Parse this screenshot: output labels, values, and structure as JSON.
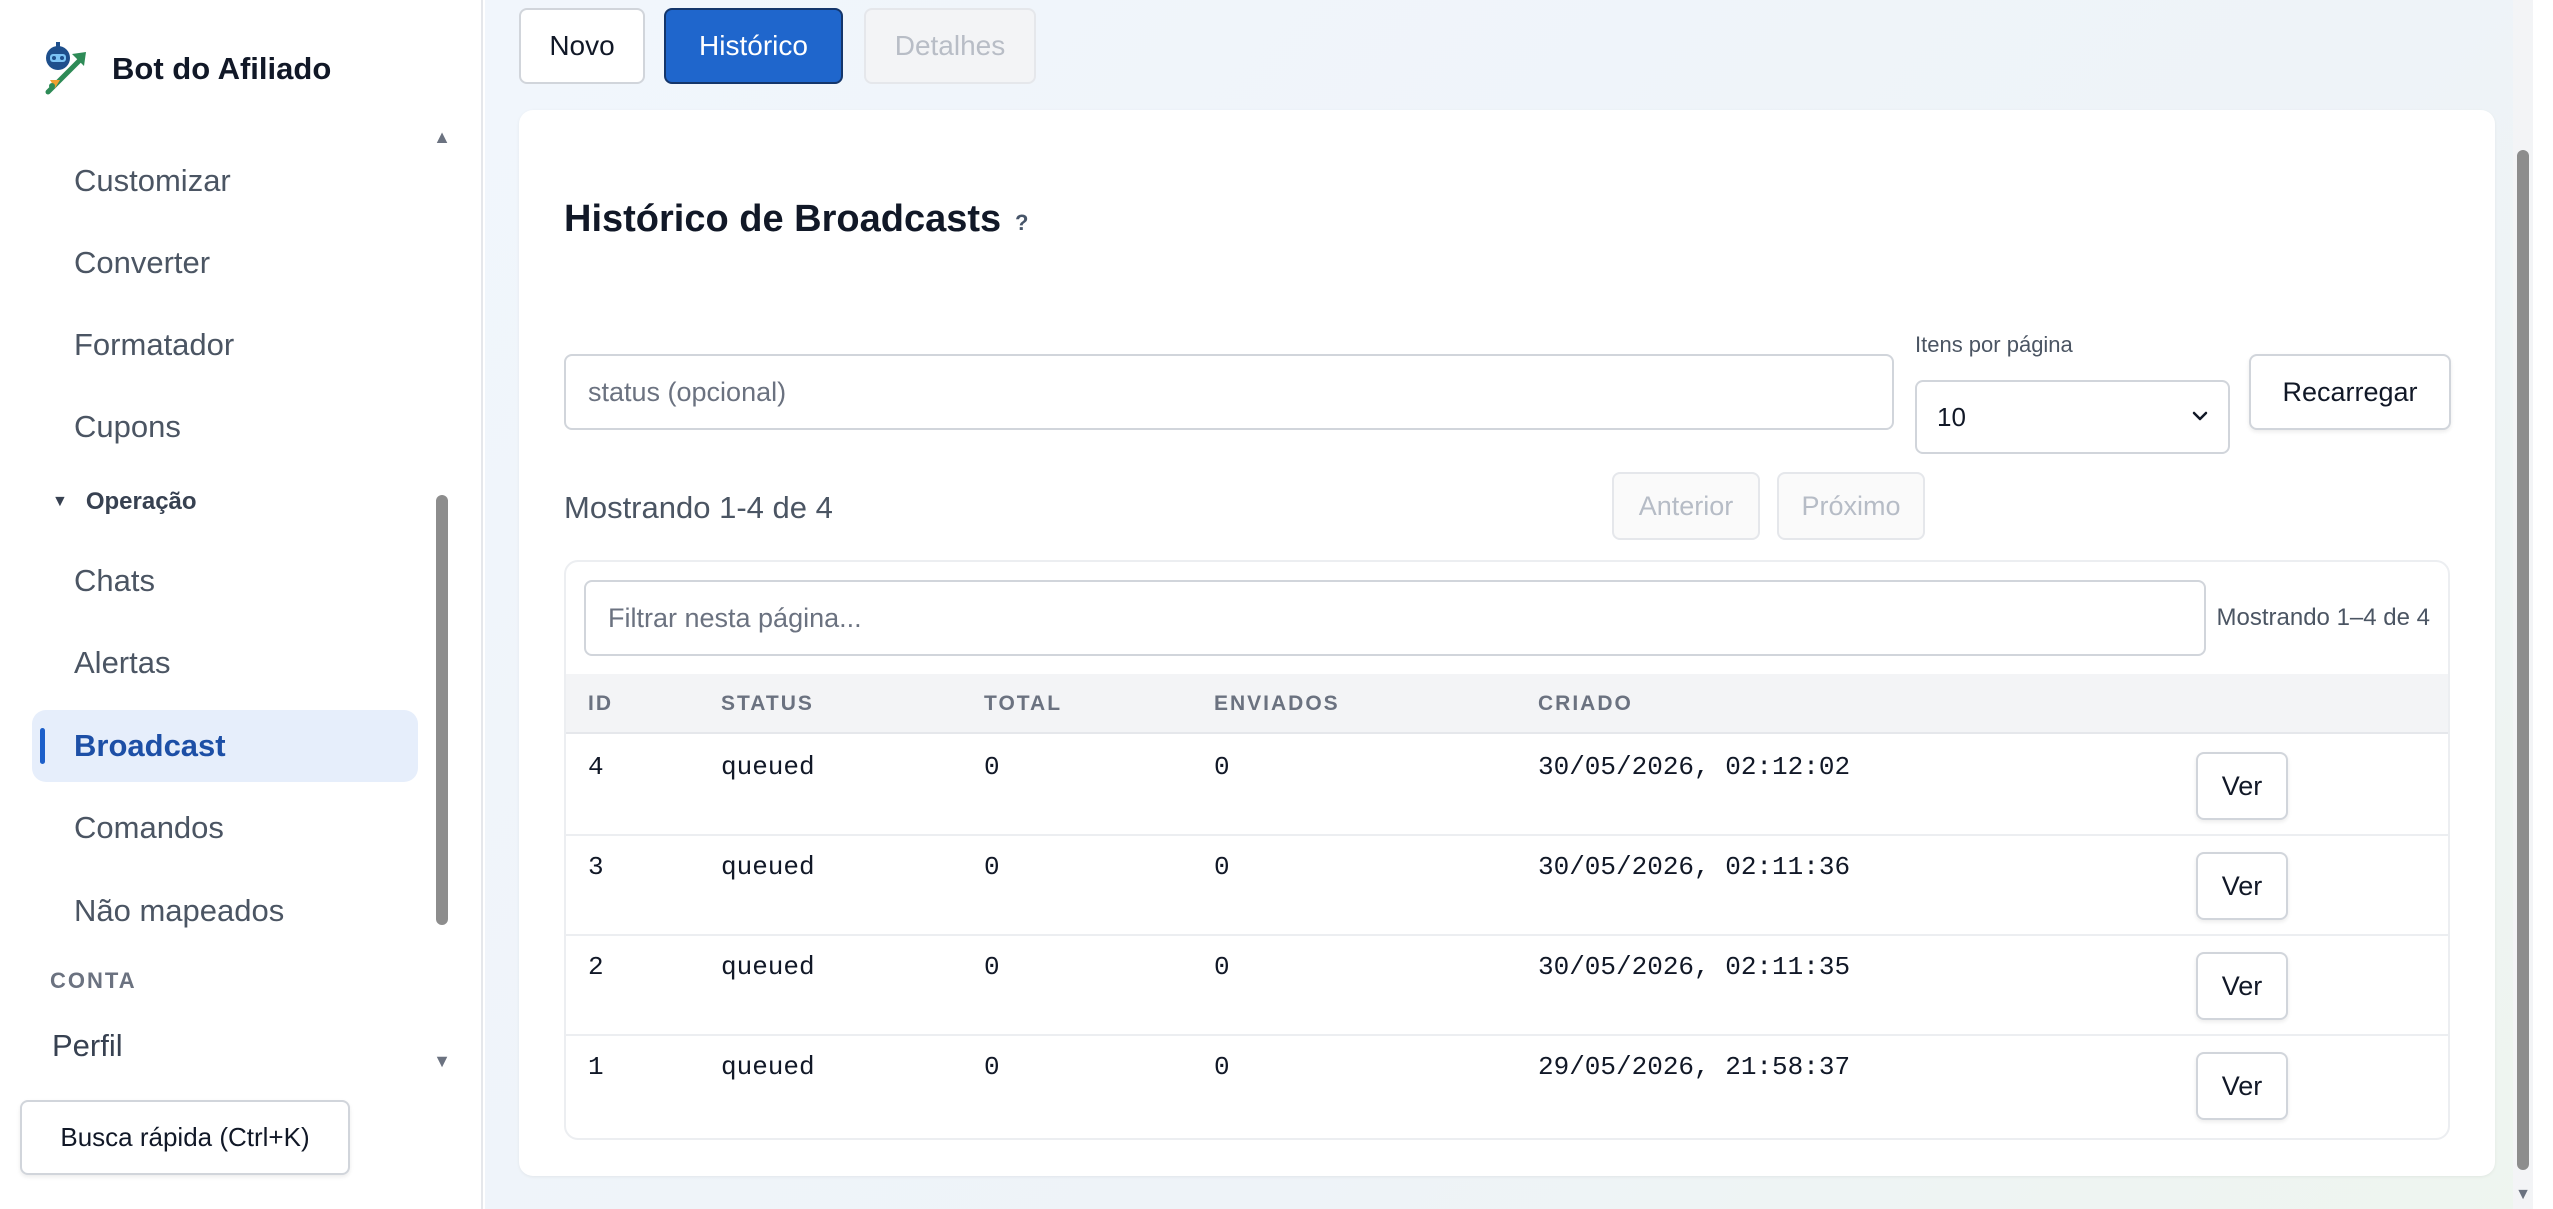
{
  "brand": {
    "name": "Bot do Afiliado",
    "logo": "robot-rocket-logo"
  },
  "sidebar": {
    "items": [
      {
        "label": "Customizar"
      },
      {
        "label": "Converter"
      },
      {
        "label": "Formatador"
      },
      {
        "label": "Cupons"
      }
    ],
    "group": {
      "label": "Operação",
      "icon": "caret-down-icon"
    },
    "group_items": [
      {
        "label": "Chats"
      },
      {
        "label": "Alertas"
      },
      {
        "label": "Broadcast",
        "active": true
      },
      {
        "label": "Comandos"
      },
      {
        "label": "Não mapeados"
      }
    ],
    "section_label": "CONTA",
    "account_items": [
      {
        "label": "Perfil"
      }
    ],
    "quick_search": "Busca rápida (Ctrl+K)"
  },
  "tabs": [
    {
      "label": "Novo",
      "state": "default"
    },
    {
      "label": "Histórico",
      "state": "active"
    },
    {
      "label": "Detalhes",
      "state": "disabled"
    }
  ],
  "card": {
    "title": "Histórico de Broadcasts",
    "help": "?",
    "status_placeholder": "status (opcional)",
    "items_per_page_label": "Itens por página",
    "items_per_page_value": "10",
    "reload_label": "Recarregar",
    "showing_text": "Mostrando 1-4 de 4",
    "prev_label": "Anterior",
    "next_label": "Próximo"
  },
  "table": {
    "filter_placeholder": "Filtrar nesta página...",
    "showing_text": "Mostrando 1–4 de 4",
    "columns": [
      "ID",
      "STATUS",
      "TOTAL",
      "ENVIADOS",
      "CRIADO"
    ],
    "rows": [
      {
        "id": "4",
        "status": "queued",
        "total": "0",
        "enviados": "0",
        "criado": "30/05/2026, 02:12:02",
        "action": "Ver"
      },
      {
        "id": "3",
        "status": "queued",
        "total": "0",
        "enviados": "0",
        "criado": "30/05/2026, 02:11:36",
        "action": "Ver"
      },
      {
        "id": "2",
        "status": "queued",
        "total": "0",
        "enviados": "0",
        "criado": "30/05/2026, 02:11:35",
        "action": "Ver"
      },
      {
        "id": "1",
        "status": "queued",
        "total": "0",
        "enviados": "0",
        "criado": "29/05/2026, 21:58:37",
        "action": "Ver"
      }
    ]
  },
  "colors": {
    "accent": "#1f66cc",
    "active_nav_bg": "#e6eefb",
    "active_nav_text": "#1d4fa6"
  }
}
